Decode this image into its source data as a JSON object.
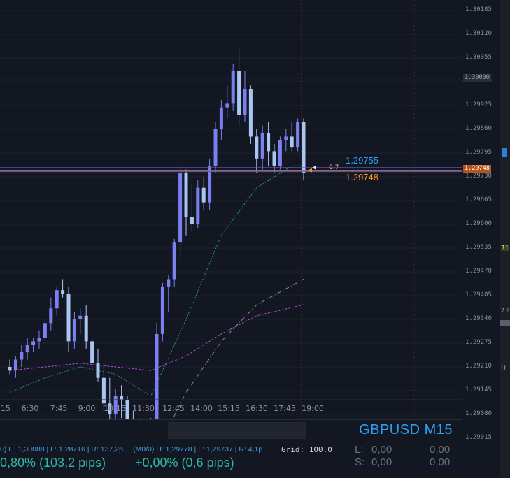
{
  "symbol": "GBPUSD M15",
  "price_scale": [
    "1.30185",
    "1.30120",
    "1.30055",
    "1.29990",
    "1.29925",
    "1.29860",
    "1.29795",
    "1.29730",
    "1.29665",
    "1.29600",
    "1.29535",
    "1.29470",
    "1.29405",
    "1.29340",
    "1.29275",
    "1.29210",
    "1.29145",
    "1.29080",
    "1.29015"
  ],
  "time_labels": [
    ":15",
    "6:30",
    "7:45",
    "9:00",
    "10:15",
    "11:30",
    "12:45",
    "14:00",
    "15:15",
    "16:30",
    "17:45",
    "19:00"
  ],
  "price_boxes": {
    "level": "1.30000",
    "current": "1.29748"
  },
  "bid_ask": {
    "ask": "1.29755",
    "bid": "1.29748",
    "ratio": "0.7"
  },
  "stats": {
    "left_small": "0) H: 1,30088 | L: 1,28716 | R: 137,2p",
    "left_big": "0,80%  (103,2 pips)",
    "mid_small": "(M0/0) H: 1,29778 | L: 1,29737 | R: 4,1p",
    "mid_big": "+0,00%  (0,6 pips)",
    "grid": "Grid: 100.0"
  },
  "ls": {
    "l_label": "L:",
    "s_label": "S:",
    "l_val1": "0,00",
    "s_val1": "0,00",
    "l_val2": "0,00",
    "s_val2": "0,00"
  },
  "side_panel": {
    "t1": "11",
    "t2": "7 €",
    "t3": "0"
  },
  "colors": {
    "bull": "#7b7ff0",
    "bear": "#a9c6f2",
    "bg": "#131722",
    "accent": "#2aa3f7",
    "bid": "#f7931a"
  },
  "chart_data": {
    "type": "candlestick",
    "ylim": [
      1.29015,
      1.30185
    ],
    "candles": [
      [
        1.2921,
        1.2923,
        1.2919,
        1.292
      ],
      [
        1.292,
        1.2924,
        1.2918,
        1.2923
      ],
      [
        1.2923,
        1.2927,
        1.2921,
        1.2925
      ],
      [
        1.2925,
        1.2929,
        1.2923,
        1.2927
      ],
      [
        1.2927,
        1.2929,
        1.2925,
        1.2928
      ],
      [
        1.2928,
        1.2931,
        1.2926,
        1.2929
      ],
      [
        1.2929,
        1.2934,
        1.2927,
        1.2933
      ],
      [
        1.2933,
        1.294,
        1.2931,
        1.2937
      ],
      [
        1.2937,
        1.2943,
        1.2935,
        1.2942
      ],
      [
        1.2942,
        1.2945,
        1.294,
        1.2941
      ],
      [
        1.2941,
        1.2943,
        1.2925,
        1.2928
      ],
      [
        1.2928,
        1.2936,
        1.2926,
        1.2934
      ],
      [
        1.2934,
        1.2937,
        1.293,
        1.2935
      ],
      [
        1.2935,
        1.2938,
        1.2926,
        1.2928
      ],
      [
        1.2928,
        1.2929,
        1.292,
        1.2922
      ],
      [
        1.2922,
        1.2926,
        1.2917,
        1.2918
      ],
      [
        1.2918,
        1.2922,
        1.2909,
        1.2911
      ],
      [
        1.2911,
        1.2918,
        1.2902,
        1.2908
      ],
      [
        1.2908,
        1.2915,
        1.2905,
        1.2913
      ],
      [
        1.2913,
        1.2916,
        1.2907,
        1.2912
      ],
      [
        1.2912,
        1.2913,
        1.2903,
        1.2906
      ],
      [
        1.2906,
        1.2909,
        1.2901,
        1.2904
      ],
      [
        1.2904,
        1.2907,
        1.2899,
        1.2902
      ],
      [
        1.2902,
        1.2906,
        1.2898,
        1.2905
      ],
      [
        1.2905,
        1.2907,
        1.29,
        1.2903
      ],
      [
        1.2903,
        1.2933,
        1.2901,
        1.293
      ],
      [
        1.293,
        1.2944,
        1.2928,
        1.2943
      ],
      [
        1.2943,
        1.2946,
        1.2936,
        1.2945
      ],
      [
        1.2945,
        1.2956,
        1.2943,
        1.2955
      ],
      [
        1.2955,
        1.2976,
        1.295,
        1.2974
      ],
      [
        1.2974,
        1.2975,
        1.2957,
        1.2962
      ],
      [
        1.2962,
        1.2971,
        1.2958,
        1.296
      ],
      [
        1.296,
        1.2972,
        1.2959,
        1.297
      ],
      [
        1.297,
        1.2973,
        1.2964,
        1.2966
      ],
      [
        1.2966,
        1.2978,
        1.2964,
        1.2976
      ],
      [
        1.2976,
        1.2988,
        1.2974,
        1.2986
      ],
      [
        1.2986,
        1.2994,
        1.2983,
        1.2992
      ],
      [
        1.2992,
        1.2998,
        1.2989,
        1.2993
      ],
      [
        1.2993,
        1.3004,
        1.2991,
        1.3002
      ],
      [
        1.3002,
        1.3008,
        1.2987,
        1.299
      ],
      [
        1.299,
        1.3002,
        1.2988,
        1.2997
      ],
      [
        1.2997,
        1.2998,
        1.2982,
        1.2984
      ],
      [
        1.2984,
        1.2986,
        1.2974,
        1.2978
      ],
      [
        1.2978,
        1.2987,
        1.2975,
        1.2985
      ],
      [
        1.2985,
        1.2988,
        1.2976,
        1.298
      ],
      [
        1.298,
        1.2982,
        1.2974,
        1.2976
      ],
      [
        1.2976,
        1.2984,
        1.2975,
        1.2983
      ],
      [
        1.2983,
        1.2986,
        1.298,
        1.2984
      ],
      [
        1.2984,
        1.2988,
        1.298,
        1.2981
      ],
      [
        1.2981,
        1.2989,
        1.298,
        1.2988
      ],
      [
        1.2988,
        1.2989,
        1.2972,
        1.2974
      ]
    ],
    "ma_green": [
      [
        0,
        1.2914
      ],
      [
        6,
        1.2918
      ],
      [
        12,
        1.2921
      ],
      [
        18,
        1.2919
      ],
      [
        24,
        1.2913
      ],
      [
        30,
        1.2934
      ],
      [
        36,
        1.2957
      ],
      [
        42,
        1.297
      ],
      [
        48,
        1.2976
      ],
      [
        50,
        1.2976
      ]
    ],
    "ma_purple": [
      [
        0,
        1.292
      ],
      [
        12,
        1.2922
      ],
      [
        24,
        1.292
      ],
      [
        30,
        1.2924
      ],
      [
        36,
        1.293
      ],
      [
        42,
        1.2935
      ],
      [
        50,
        1.2938
      ]
    ],
    "ma_gray": [
      [
        0,
        1.2898
      ],
      [
        12,
        1.289
      ],
      [
        24,
        1.2895
      ],
      [
        30,
        1.2914
      ],
      [
        36,
        1.2928
      ],
      [
        42,
        1.2938
      ],
      [
        50,
        1.2945
      ]
    ]
  }
}
